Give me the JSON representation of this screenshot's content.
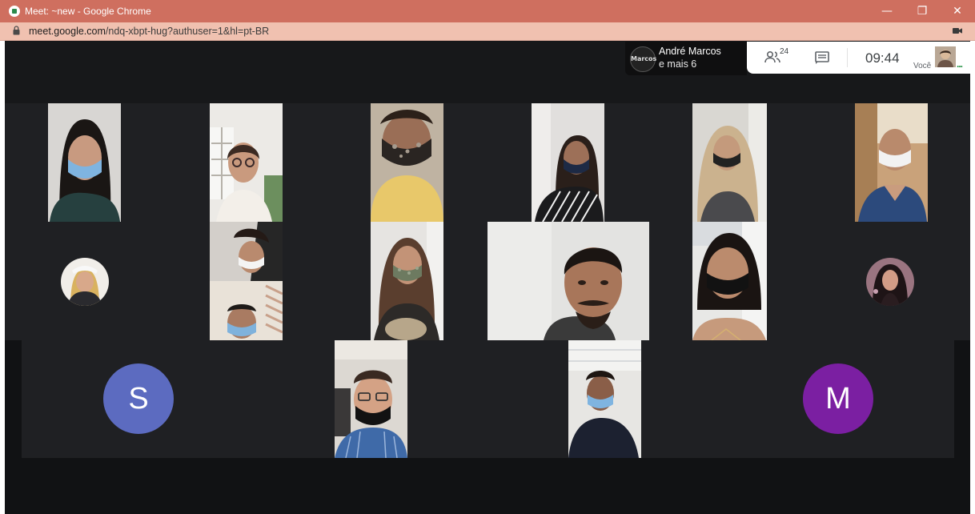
{
  "window": {
    "title": "Meet: ~new - Google Chrome",
    "minimize_glyph": "—",
    "restore_glyph": "❐",
    "close_glyph": "✕"
  },
  "address_bar": {
    "host": "meet.google.com",
    "path": "/ndq-xbpt-hug?authuser=1&hl=pt-BR"
  },
  "speaker": {
    "logo_text": "Marcos",
    "name": "André Marcos",
    "others": "e mais 6"
  },
  "toolbar": {
    "participant_count": "24",
    "clock": "09:44",
    "self_label": "Você",
    "more_glyph": "..."
  },
  "avatars": {
    "S": "S",
    "M": "M"
  },
  "colors": {
    "titlebar": "#cf6f5f",
    "addressbar": "#f0c1b0",
    "meet_background": "#111214",
    "tile_background": "#1f2023",
    "avatar_s": "#5c6bc0",
    "avatar_m": "#7b1fa2"
  }
}
